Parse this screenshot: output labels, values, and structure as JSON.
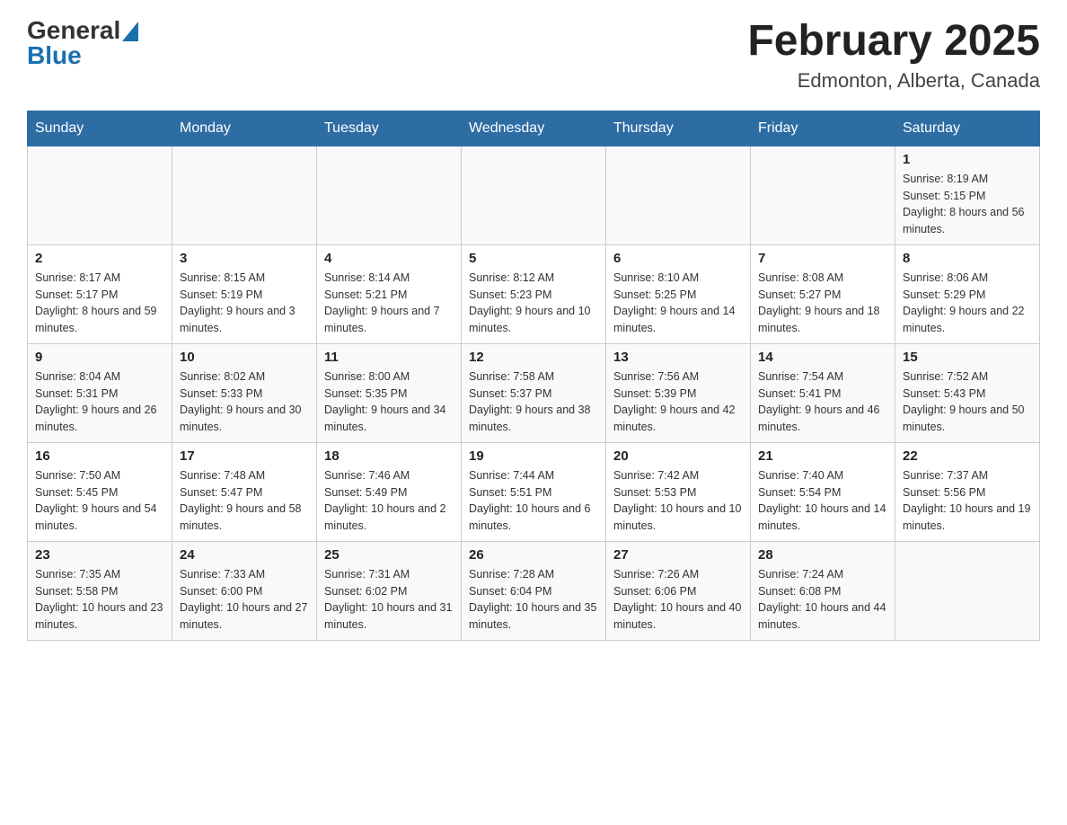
{
  "header": {
    "title": "February 2025",
    "subtitle": "Edmonton, Alberta, Canada",
    "logo_general": "General",
    "logo_blue": "Blue"
  },
  "days_of_week": [
    "Sunday",
    "Monday",
    "Tuesday",
    "Wednesday",
    "Thursday",
    "Friday",
    "Saturday"
  ],
  "weeks": [
    {
      "days": [
        {
          "number": "",
          "info": ""
        },
        {
          "number": "",
          "info": ""
        },
        {
          "number": "",
          "info": ""
        },
        {
          "number": "",
          "info": ""
        },
        {
          "number": "",
          "info": ""
        },
        {
          "number": "",
          "info": ""
        },
        {
          "number": "1",
          "info": "Sunrise: 8:19 AM\nSunset: 5:15 PM\nDaylight: 8 hours and 56 minutes."
        }
      ]
    },
    {
      "days": [
        {
          "number": "2",
          "info": "Sunrise: 8:17 AM\nSunset: 5:17 PM\nDaylight: 8 hours and 59 minutes."
        },
        {
          "number": "3",
          "info": "Sunrise: 8:15 AM\nSunset: 5:19 PM\nDaylight: 9 hours and 3 minutes."
        },
        {
          "number": "4",
          "info": "Sunrise: 8:14 AM\nSunset: 5:21 PM\nDaylight: 9 hours and 7 minutes."
        },
        {
          "number": "5",
          "info": "Sunrise: 8:12 AM\nSunset: 5:23 PM\nDaylight: 9 hours and 10 minutes."
        },
        {
          "number": "6",
          "info": "Sunrise: 8:10 AM\nSunset: 5:25 PM\nDaylight: 9 hours and 14 minutes."
        },
        {
          "number": "7",
          "info": "Sunrise: 8:08 AM\nSunset: 5:27 PM\nDaylight: 9 hours and 18 minutes."
        },
        {
          "number": "8",
          "info": "Sunrise: 8:06 AM\nSunset: 5:29 PM\nDaylight: 9 hours and 22 minutes."
        }
      ]
    },
    {
      "days": [
        {
          "number": "9",
          "info": "Sunrise: 8:04 AM\nSunset: 5:31 PM\nDaylight: 9 hours and 26 minutes."
        },
        {
          "number": "10",
          "info": "Sunrise: 8:02 AM\nSunset: 5:33 PM\nDaylight: 9 hours and 30 minutes."
        },
        {
          "number": "11",
          "info": "Sunrise: 8:00 AM\nSunset: 5:35 PM\nDaylight: 9 hours and 34 minutes."
        },
        {
          "number": "12",
          "info": "Sunrise: 7:58 AM\nSunset: 5:37 PM\nDaylight: 9 hours and 38 minutes."
        },
        {
          "number": "13",
          "info": "Sunrise: 7:56 AM\nSunset: 5:39 PM\nDaylight: 9 hours and 42 minutes."
        },
        {
          "number": "14",
          "info": "Sunrise: 7:54 AM\nSunset: 5:41 PM\nDaylight: 9 hours and 46 minutes."
        },
        {
          "number": "15",
          "info": "Sunrise: 7:52 AM\nSunset: 5:43 PM\nDaylight: 9 hours and 50 minutes."
        }
      ]
    },
    {
      "days": [
        {
          "number": "16",
          "info": "Sunrise: 7:50 AM\nSunset: 5:45 PM\nDaylight: 9 hours and 54 minutes."
        },
        {
          "number": "17",
          "info": "Sunrise: 7:48 AM\nSunset: 5:47 PM\nDaylight: 9 hours and 58 minutes."
        },
        {
          "number": "18",
          "info": "Sunrise: 7:46 AM\nSunset: 5:49 PM\nDaylight: 10 hours and 2 minutes."
        },
        {
          "number": "19",
          "info": "Sunrise: 7:44 AM\nSunset: 5:51 PM\nDaylight: 10 hours and 6 minutes."
        },
        {
          "number": "20",
          "info": "Sunrise: 7:42 AM\nSunset: 5:53 PM\nDaylight: 10 hours and 10 minutes."
        },
        {
          "number": "21",
          "info": "Sunrise: 7:40 AM\nSunset: 5:54 PM\nDaylight: 10 hours and 14 minutes."
        },
        {
          "number": "22",
          "info": "Sunrise: 7:37 AM\nSunset: 5:56 PM\nDaylight: 10 hours and 19 minutes."
        }
      ]
    },
    {
      "days": [
        {
          "number": "23",
          "info": "Sunrise: 7:35 AM\nSunset: 5:58 PM\nDaylight: 10 hours and 23 minutes."
        },
        {
          "number": "24",
          "info": "Sunrise: 7:33 AM\nSunset: 6:00 PM\nDaylight: 10 hours and 27 minutes."
        },
        {
          "number": "25",
          "info": "Sunrise: 7:31 AM\nSunset: 6:02 PM\nDaylight: 10 hours and 31 minutes."
        },
        {
          "number": "26",
          "info": "Sunrise: 7:28 AM\nSunset: 6:04 PM\nDaylight: 10 hours and 35 minutes."
        },
        {
          "number": "27",
          "info": "Sunrise: 7:26 AM\nSunset: 6:06 PM\nDaylight: 10 hours and 40 minutes."
        },
        {
          "number": "28",
          "info": "Sunrise: 7:24 AM\nSunset: 6:08 PM\nDaylight: 10 hours and 44 minutes."
        },
        {
          "number": "",
          "info": ""
        }
      ]
    }
  ]
}
